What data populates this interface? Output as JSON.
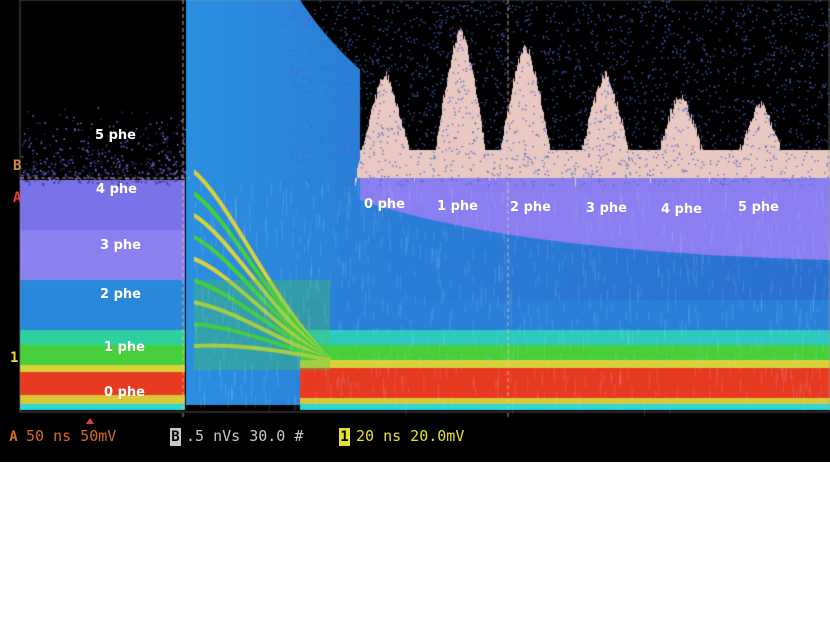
{
  "colors": {
    "background": "#000000",
    "purple": "#8a7ef0",
    "blue": "#2a8fe0",
    "cyan": "#2ed6d6",
    "green": "#3ccf3c",
    "yellow": "#d8d23a",
    "red": "#e83a20",
    "pink": "#e8c8c0",
    "label": "#ffffff",
    "status_orange": "#d86a20",
    "status_grey": "#c8c8c8",
    "status_yellow": "#e8e030"
  },
  "amplitude_labels": [
    "5 phe",
    "4 phe",
    "3 phe",
    "2 phe",
    "1 phe",
    "0 phe"
  ],
  "histogram_labels": [
    "0 phe",
    "1 phe",
    "2 phe",
    "3 phe",
    "4 phe",
    "5 phe"
  ],
  "markers": {
    "b": "B",
    "a": "A",
    "one": "1"
  },
  "status": {
    "a_chip": "A",
    "a_text": "50 ns  50mV",
    "b_chip": "B",
    "b_text": ".5 nVs 30.0 #",
    "ch1_chip": "1",
    "ch1_text": "20 ns 20.0mV"
  }
}
